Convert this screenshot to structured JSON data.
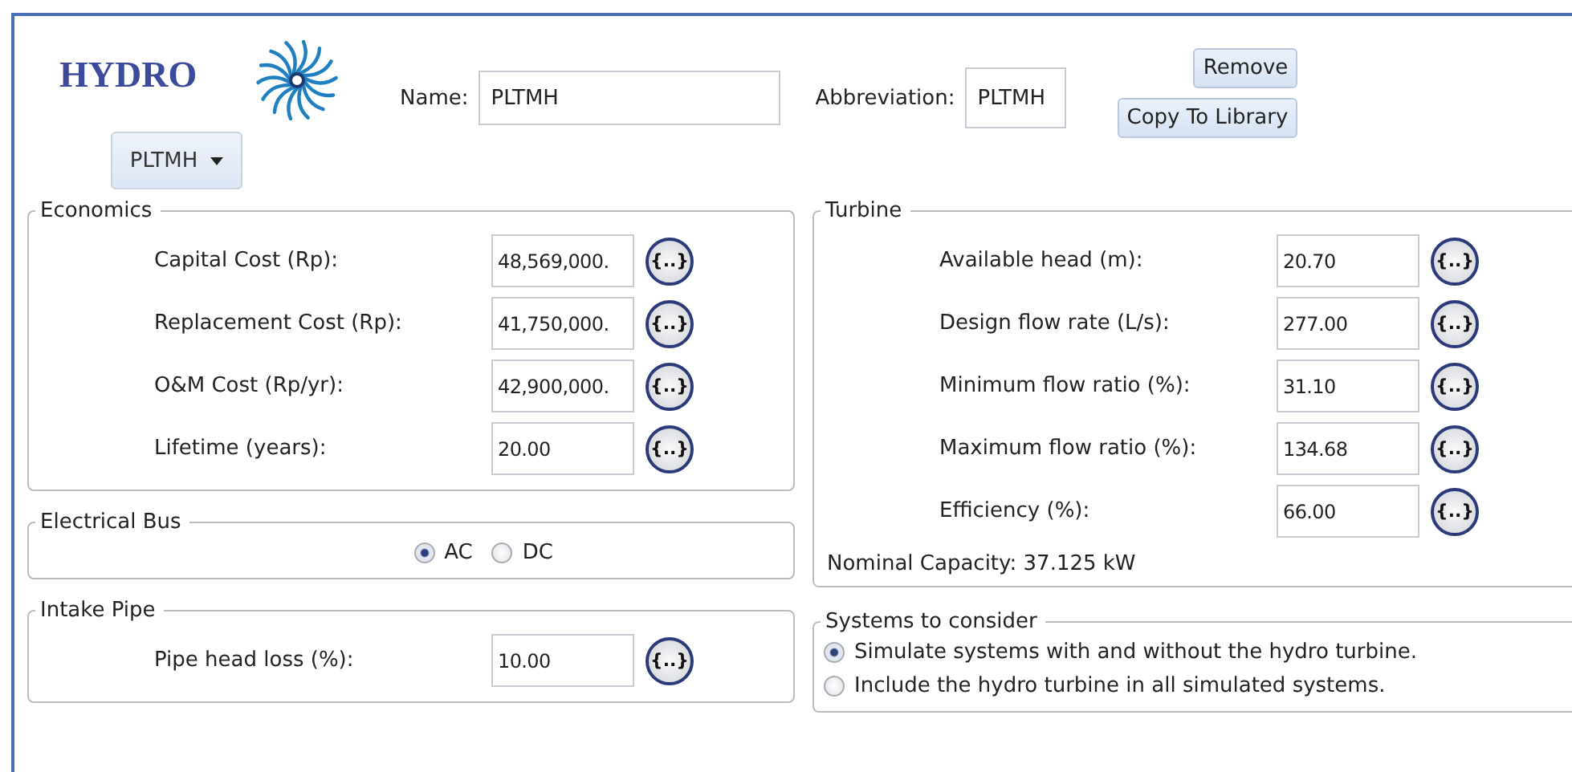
{
  "header": {
    "title": "HYDRO",
    "dropdown": "PLTMH",
    "name_label": "Name:",
    "name_value": "PLTMH",
    "abbreviation_label": "Abbreviation:",
    "abbreviation_value": "PLTMH",
    "buttons": [
      "Remove",
      "Copy To Library"
    ]
  },
  "economics": {
    "title": "Economics",
    "fields": [
      {
        "label": "Capital Cost (Rp):",
        "value": "48,569,000.",
        "action": "{..}"
      },
      {
        "label": "Replacement Cost (Rp):",
        "value": "41,750,000.",
        "action": "{..}"
      },
      {
        "label": "O&M Cost (Rp/yr):",
        "value": "42,900,000.",
        "action": "{..}"
      },
      {
        "label": "Lifetime (years):",
        "value": "20.00",
        "action": "{..}"
      }
    ]
  },
  "electrical_bus": {
    "title": "Electrical Bus",
    "options": [
      {
        "label": "AC",
        "selected": true
      },
      {
        "label": "DC",
        "selected": false
      }
    ]
  },
  "intake_pipe": {
    "title": "Intake Pipe",
    "fields": [
      {
        "label": "Pipe head loss (%):",
        "value": "10.00",
        "action": "{..}"
      }
    ]
  },
  "turbine": {
    "title": "Turbine",
    "fields": [
      {
        "label": "Available head (m):",
        "value": "20.70",
        "action": "{..}"
      },
      {
        "label": "Design flow rate (L/s):",
        "value": "277.00",
        "action": "{..}"
      },
      {
        "label": "Minimum flow ratio (%):",
        "value": "31.10",
        "action": "{..}"
      },
      {
        "label": "Maximum flow ratio (%):",
        "value": "134.68",
        "action": "{..}"
      },
      {
        "label": "Efficiency (%):",
        "value": "66.00",
        "action": "{..}"
      }
    ],
    "nominal_capacity": "Nominal Capacity: 37.125 kW"
  },
  "systems": {
    "title": "Systems to consider",
    "options": [
      {
        "label": "Simulate systems with and without the hydro turbine.",
        "selected": true
      },
      {
        "label": "Include the hydro turbine in all simulated systems.",
        "selected": false
      }
    ]
  }
}
